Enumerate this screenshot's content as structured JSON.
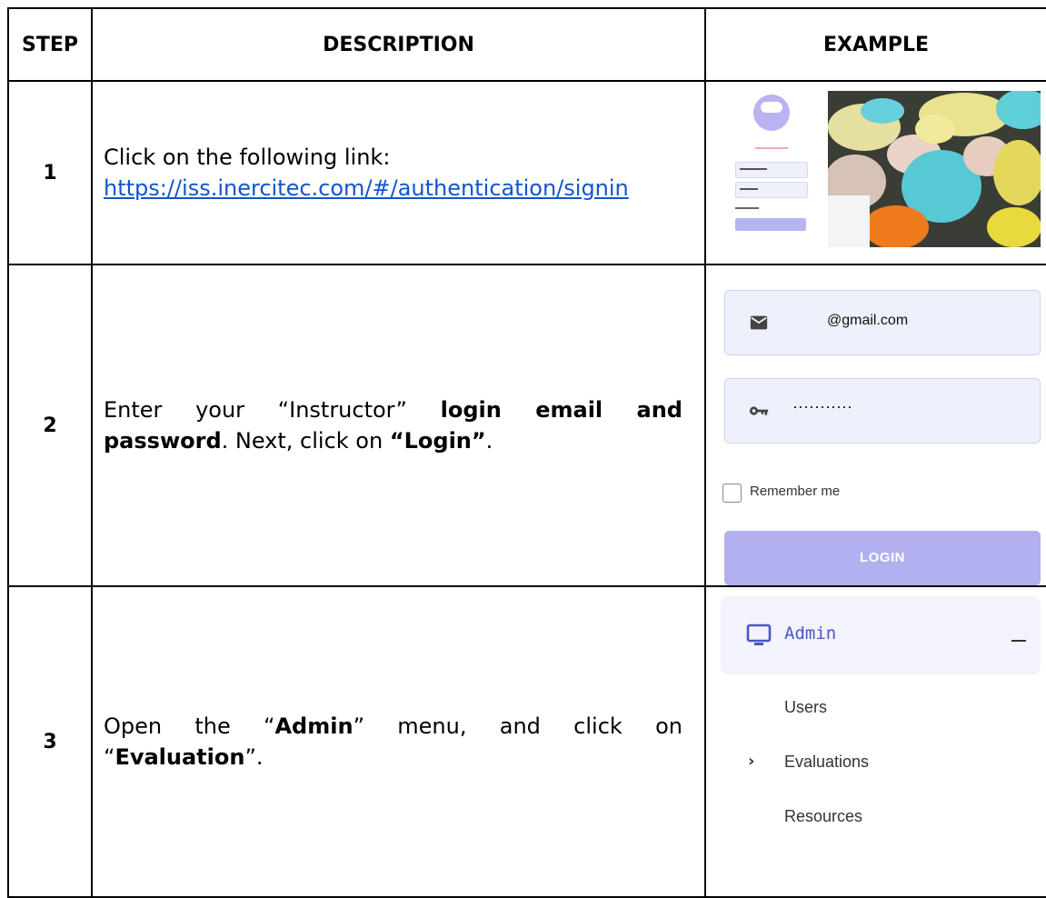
{
  "headers": {
    "step": "STEP",
    "description": "DESCRIPTION",
    "example": "EXAMPLE"
  },
  "rows": [
    {
      "step": "1",
      "text_pre": "Click on the following link:",
      "link": "https://iss.inercitec.com/#/authentication/signin"
    },
    {
      "step": "2",
      "text_a": "Enter your “Instructor” ",
      "text_b": "login email and password",
      "text_c": ". Next, click on ",
      "text_d": "“Login”",
      "text_e": ".",
      "example": {
        "email_value": "@gmail.com",
        "password_value": "···········",
        "remember_label": "Remember me",
        "login_label": "LOGIN",
        "email_icon": "mail-icon",
        "password_icon": "key-icon"
      }
    },
    {
      "step": "3",
      "text_a": "Open the “",
      "text_b": "Admin",
      "text_c": "” menu, and click on “",
      "text_d": "Evaluation",
      "text_e": "”.",
      "example": {
        "menu_label": "Admin",
        "menu_icon": "monitor-icon",
        "items": [
          "Users",
          "Evaluations",
          "Resources"
        ]
      }
    }
  ],
  "colors": {
    "link": "#1155cc",
    "accent": "#4b56c6",
    "login_button": "#b1b1f0",
    "field_bg": "#eef0fb"
  }
}
